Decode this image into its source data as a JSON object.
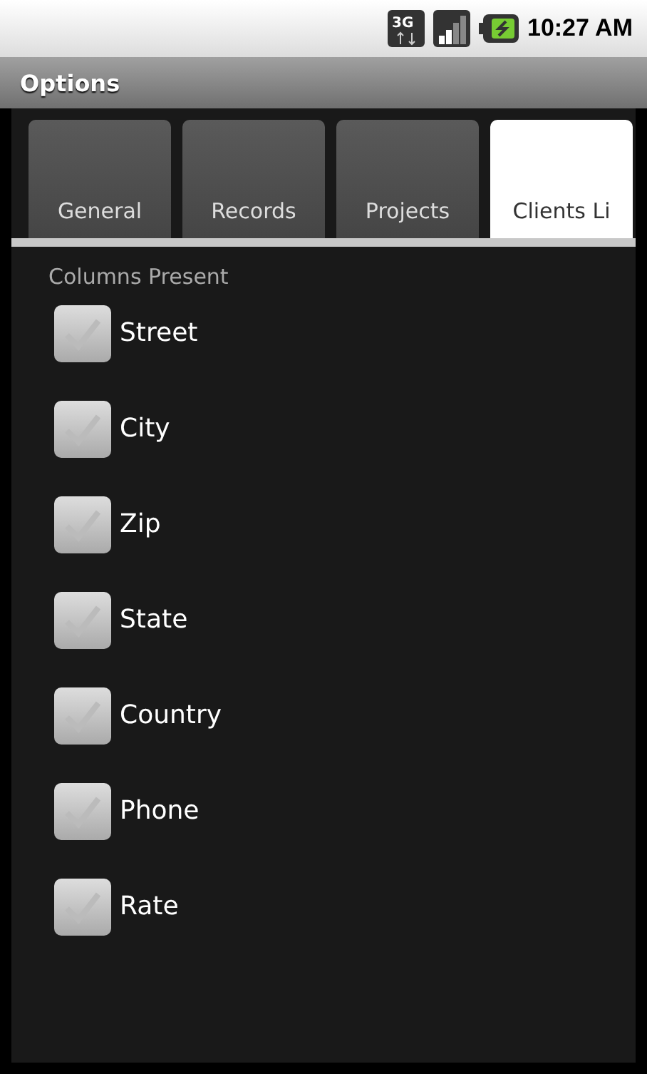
{
  "status_bar": {
    "network": "3G",
    "time": "10:27 AM"
  },
  "title_bar": {
    "title": "Options"
  },
  "tabs": [
    {
      "label": "General",
      "selected": false
    },
    {
      "label": "Records",
      "selected": false
    },
    {
      "label": "Projects",
      "selected": false
    },
    {
      "label": "Clients Li",
      "selected": true
    }
  ],
  "section": {
    "heading": "Columns Present"
  },
  "checkboxes": [
    {
      "label": "Street",
      "checked": true,
      "disabled": true
    },
    {
      "label": "City",
      "checked": true,
      "disabled": true
    },
    {
      "label": "Zip",
      "checked": true,
      "disabled": true
    },
    {
      "label": "State",
      "checked": true,
      "disabled": true
    },
    {
      "label": "Country",
      "checked": true,
      "disabled": true
    },
    {
      "label": "Phone",
      "checked": true,
      "disabled": true
    },
    {
      "label": "Rate",
      "checked": true,
      "disabled": true
    }
  ]
}
